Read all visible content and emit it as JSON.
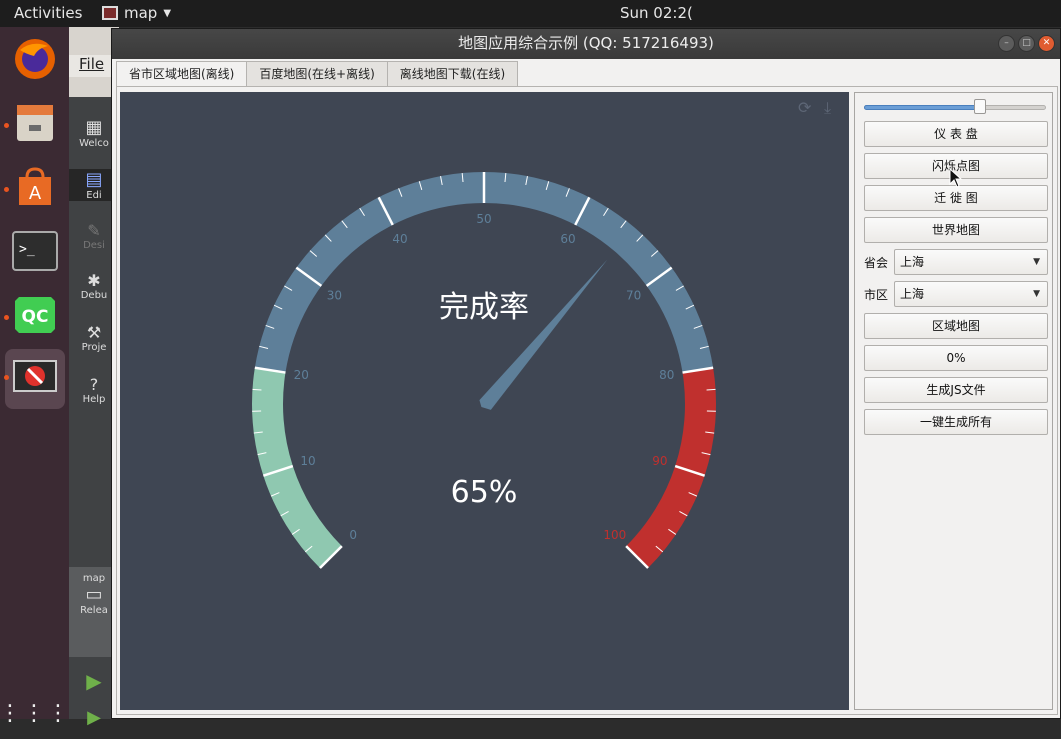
{
  "topbar": {
    "activities": "Activities",
    "app_name": "map",
    "clock": "Sun 02:2("
  },
  "dock": {
    "items": [
      "firefox",
      "files",
      "software-center",
      "terminal",
      "qt-creator",
      "map-app"
    ]
  },
  "backdrop": {
    "menu_file": "File",
    "modes": [
      "Welco",
      "Edi",
      "Desi",
      "Debu",
      "Proje",
      "Help"
    ],
    "project_label": "map",
    "build_label": "Relea"
  },
  "window": {
    "title": "地图应用综合示例 (QQ: 517216493)",
    "tabs": [
      "省市区域地图(离线)",
      "百度地图(在线+离线)",
      "离线地图下载(在线)"
    ],
    "active_tab": 0
  },
  "gauge": {
    "title": "完成率",
    "value": 65,
    "value_text": "65%",
    "min": 0,
    "max": 100,
    "tick_labels": [
      "0",
      "10",
      "20",
      "30",
      "40",
      "50",
      "60",
      "70",
      "80",
      "90",
      "100"
    ],
    "ranges": [
      {
        "from": 0,
        "to": 20,
        "color": "#8fc8b0"
      },
      {
        "from": 20,
        "to": 80,
        "color": "#5e7f99"
      },
      {
        "from": 80,
        "to": 100,
        "color": "#c0302e"
      }
    ],
    "background": "#3f4653",
    "pointer_color": "#5e7f99",
    "label_colors": {
      "normal": "#5e7f99",
      "danger": "#c0302e"
    }
  },
  "sidebar": {
    "slider_value": 0.64,
    "buttons": {
      "dashboard": "仪 表 盘",
      "flash_points": "闪烁点图",
      "migration": "迁 徙 图",
      "world_map": "世界地图",
      "region_map": "区域地图",
      "progress": "0%",
      "gen_js": "生成JS文件",
      "gen_all": "一键生成所有"
    },
    "province": {
      "label": "省会",
      "value": "上海"
    },
    "city": {
      "label": "市区",
      "value": "上海"
    }
  }
}
